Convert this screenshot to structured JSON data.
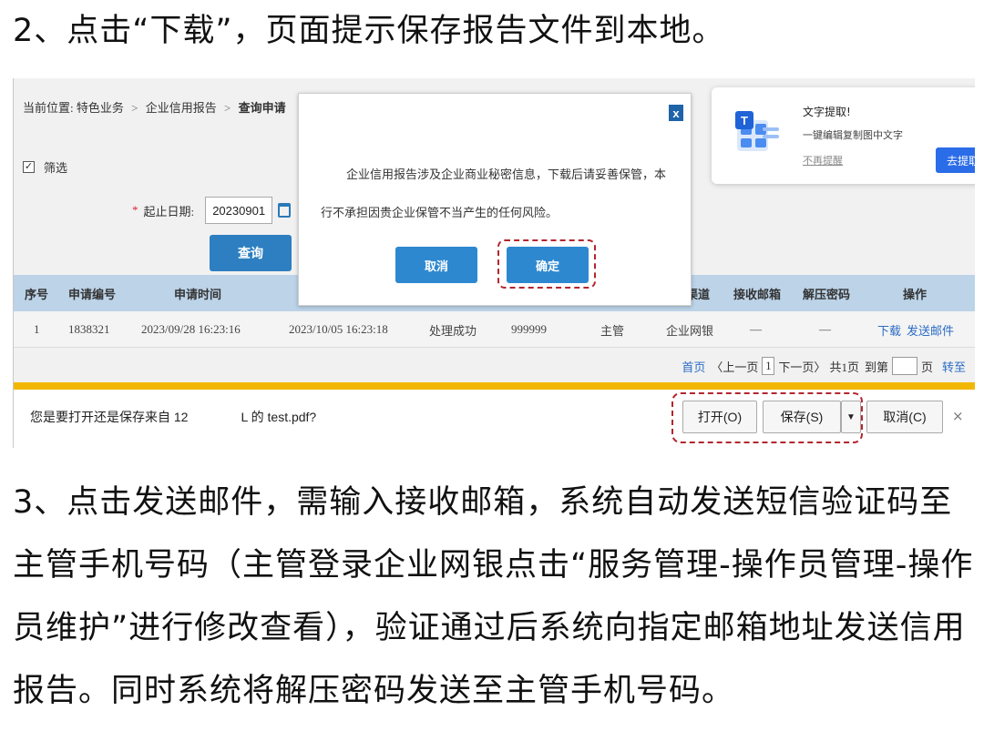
{
  "step2": "2、点击“下载”，页面提示保存报告文件到本地。",
  "step3": "3、点击发送邮件，需输入接收邮箱，系统自动发送短信验证码至主管手机号码（主管登录企业网银点击“服务管理-操作员管理-操作员维护”进行修改查看），验证通过后系统向指定邮箱地址发送信用报告。同时系统将解压密码发送至主管手机号码。",
  "breadcrumb": {
    "prefix": "当前位置:",
    "item1": "特色业务",
    "item2": "企业信用报告",
    "current": "查询申请",
    "sep": ">"
  },
  "filter": {
    "label": "筛选",
    "checked": true
  },
  "date": {
    "label": "起止日期:",
    "value": "20230901",
    "required": "*"
  },
  "query_button": "查询",
  "table": {
    "headers": {
      "seq": "序号",
      "app_no": "申请编号",
      "app_time": "申请时间",
      "channel": "渠道",
      "email": "接收邮箱",
      "password": "解压密码",
      "action": "操作"
    },
    "row": {
      "seq": "1",
      "app_no": "1838321",
      "app_time": "2023/09/28 16:23:16",
      "done_time": "2023/10/05 16:23:18",
      "status": "处理成功",
      "code": "999999",
      "role": "主管",
      "channel": "企业网银",
      "email": "—",
      "password": "—",
      "download": "下载",
      "send_email": "发送邮件"
    }
  },
  "pager": {
    "first": "首页",
    "prev": "〈上一页",
    "page": "1",
    "next": "下一页〉",
    "total": "共1页",
    "goto": "到第",
    "page_unit": "页",
    "jump": "转至"
  },
  "modal": {
    "message": "企业信用报告涉及企业商业秘密信息，下载后请妥善保管，本行不承担因贵企业保管不当产生的任何风险。",
    "cancel": "取消",
    "confirm": "确定",
    "close": "x"
  },
  "ocr_popup": {
    "title": "文字提取!",
    "subtitle": "一键编辑复制图中文字",
    "dismiss": "不再提醒",
    "button": "去提取"
  },
  "download_bar": {
    "message_start": "您是要打开还是保存来自 12",
    "message_end": "L 的 test.pdf?",
    "open": "打开(O)",
    "save": "保存(S)",
    "dropdown": "▼",
    "cancel": "取消(C)",
    "close": "×"
  },
  "colors": {
    "primary_button": "#2d88d0",
    "highlight": "#b3262e",
    "table_header": "#bcd3e8",
    "download_bar_accent": "#f2b705",
    "link": "#2b6cc4"
  }
}
